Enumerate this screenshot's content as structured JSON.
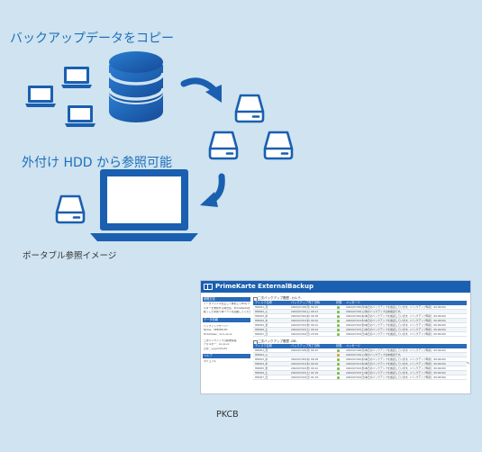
{
  "heading_copy": "バックアップデータをコピー",
  "heading_hdd": "外付け HDD から参照可能",
  "caption_portable": "ポータブル参照イメージ",
  "caption_pkcb": "PKCB",
  "colors": {
    "background": "#cfe3f0",
    "accent": "#1f6fba",
    "icon_blue": "#1a5fb0",
    "ok_status": "#7bbf4a",
    "warn_status": "#e0a020"
  },
  "icons": [
    "laptop-icon",
    "database-icon",
    "arrow-curve-icon",
    "hard-drive-icon"
  ],
  "screenshot": {
    "app_title": "PrimeKarte ExternalBackup",
    "sidebar": {
      "section1_title": "参照方法",
      "section1_lines": [
        "データファイルを正しく参照してPCのフォ",
        "ルダーを参照する場合は、PrimeKarteを",
        "終了した状態で本ソフトを起動してください。"
      ],
      "section2_title": "データ情報",
      "item1": "バックアップサーバー",
      "item1_lines": [
        "Name：SERVER-PC",
        "IP Address：xx.x.xx.xx"
      ],
      "item2": "二次バックアップ元端末情報",
      "item2_lines": [
        "フォルダー：xx.xx.xx",
        "日付：yyyy/mm/dd"
      ],
      "section3_title": "ヘルプ",
      "item3": "マニュアル"
    },
    "table1": {
      "title": "二次バックアップ履歴 -カルテ-",
      "headers": [
        "ディスク名称",
        "バックアップ完了日時",
        "状態",
        "メッセージ"
      ],
      "rows": [
        {
          "name": "HDD01_月",
          "date": "2022/07/18(月) 00:15",
          "status": "ok",
          "msg": "2022/07/18(月)本日のバックアップを確認しています。(バックアップ時刻：00:00:00)"
        },
        {
          "name": "HDD02_火",
          "date": "2022/07/19(火) 00:11",
          "status": "ok",
          "msg": "2022/07/19(火)他のバックアップは未確認です。"
        },
        {
          "name": "HDD03_水",
          "date": "2022/07/20(水) 00:18",
          "status": "ok",
          "msg": "2022/07/20(水)本日のバックアップを確認しています。(バックアップ時刻：00:00:00)"
        },
        {
          "name": "HDD04_木",
          "date": "2022/07/21(木) 00:10",
          "status": "ok",
          "msg": "2022/07/21(木)本日のバックアップを確認しています。(バックアップ時刻：00:00:00)"
        },
        {
          "name": "HDD05_金",
          "date": "2022/07/22(金) 00:12",
          "status": "ok",
          "msg": "2022/07/22(金)本日のバックアップを確認しています。(バックアップ時刻：00:00:00)"
        },
        {
          "name": "HDD06_土",
          "date": "2022/07/23(土) 00:14",
          "status": "ok",
          "msg": "2022/07/23(土)本日のバックアップを確認しています。(バックアップ時刻：00:00:00)"
        },
        {
          "name": "HDD07_日",
          "date": "2022/07/24(日) 23:59",
          "status": "ok",
          "msg": "2022/07/24(日)本日のバックアップを確認しています。(バックアップ時刻：00:00:00)"
        }
      ]
    },
    "table2": {
      "title": "二次バックアップ履歴 -DB-",
      "headers": [
        "ディスク名称",
        "バックアップ完了日時",
        "状態",
        "メッセージ"
      ],
      "rows": [
        {
          "name": "HDD01_月",
          "date": "2022/07/18(月) 00:15",
          "status": "ok",
          "msg": "2022/07/18(月)本日のバックアップを確認しています。(バックアップ時刻：00:00:00)"
        },
        {
          "name": "HDD02_火",
          "date": "",
          "status": "warn",
          "msg": "2022/07/19(火)他のバックアップは未確認です。"
        },
        {
          "name": "HDD03_水",
          "date": "2022/07/20(水) 00:18",
          "status": "ok",
          "msg": "2022/07/20(水)本日のバックアップを確認しています。(バックアップ時刻：00:00:00)"
        },
        {
          "name": "HDD04_木",
          "date": "2022/07/21(木) 00:10",
          "status": "ok",
          "msg": "2022/07/21(木)本日のバックアップを確認しています。(バックアップ時刻：00:00:00)"
        },
        {
          "name": "HDD05_金",
          "date": "2022/07/22(金) 00:12",
          "status": "ok",
          "msg": "2022/07/22(金)本日のバックアップを確認しています。(バックアップ時刻：00:00:00)"
        },
        {
          "name": "HDD06_土",
          "date": "2022/07/23(土) 01:19",
          "status": "ok",
          "msg": "2022/07/23(土)本日のバックアップを確認しています。(バックアップ時刻：00:00:00)"
        },
        {
          "name": "HDD07_日",
          "date": "2022/07/24(日) 01:19",
          "status": "ok",
          "msg": "2022/07/24(日)本日のバックアップを確認しています。(バックアップ時刻：00:00:00)"
        }
      ]
    }
  }
}
